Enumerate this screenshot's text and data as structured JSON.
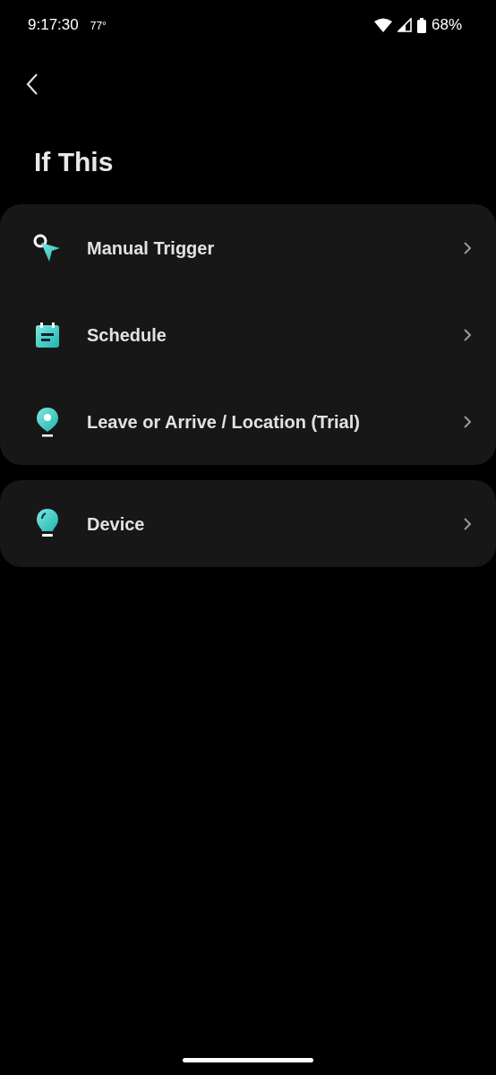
{
  "status_bar": {
    "time": "9:17:30",
    "temperature": "77°",
    "battery": "68%"
  },
  "title": "If This",
  "groups": [
    {
      "items": [
        {
          "kind": "manual",
          "label": "Manual Trigger"
        },
        {
          "kind": "schedule",
          "label": "Schedule"
        },
        {
          "kind": "location",
          "label": "Leave or Arrive / Location (Trial)"
        }
      ]
    },
    {
      "items": [
        {
          "kind": "device",
          "label": "Device"
        }
      ]
    }
  ]
}
